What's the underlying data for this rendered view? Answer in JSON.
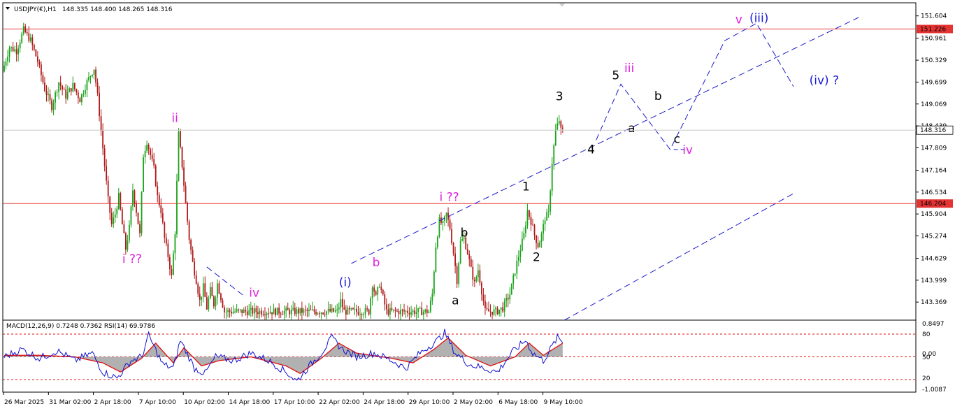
{
  "header": {
    "title": "USDJPY(€),H1",
    "ohlc": "148.335 148.400 148.265 148.316",
    "indicator_label": "MACD(12,26,9) 0.7248 0.7362  RSI(14) 69.9786"
  },
  "colors": {
    "up_candle": "#1aa31a",
    "down_candle": "#b01818",
    "hline": "#e53333",
    "price_tag_bg": "#e53333",
    "wave_blue": "#1a1ad8",
    "wave_magenta": "#e020e0",
    "wave_black": "#000000",
    "projection": "#1a1acc",
    "macd_hist": "#a8a8a8",
    "signal": "#e01010",
    "rsi": "#1010d0"
  },
  "chart_data": {
    "type": "candlestick",
    "symbol": "USDJPY(€)",
    "timeframe": "H1",
    "ylim": [
      142.85,
      151.98
    ],
    "y_ticks": [
      "151.604",
      "150.961",
      "150.329",
      "149.699",
      "149.069",
      "148.439",
      "147.809",
      "147.164",
      "146.534",
      "145.904",
      "145.274",
      "144.629",
      "143.999",
      "143.369"
    ],
    "x_ticks": [
      "26 Mar 2025",
      "31 Mar 02:00",
      "2 Apr 18:00",
      "7 Apr 10:00",
      "10 Apr 02:00",
      "14 Apr 18:00",
      "17 Apr 10:00",
      "22 Apr 02:00",
      "24 Apr 18:00",
      "29 Apr 10:00",
      "2 May 02:00",
      "6 May 18:00",
      "9 May 10:00"
    ],
    "current_price": "148.316",
    "horizontal_levels": [
      {
        "value": "151.226"
      },
      {
        "value": "146.204"
      }
    ],
    "price_path": [
      {
        "i": 0,
        "p": 150.0
      },
      {
        "i": 4,
        "p": 150.7
      },
      {
        "i": 8,
        "p": 150.6
      },
      {
        "i": 12,
        "p": 151.2
      },
      {
        "i": 16,
        "p": 150.9
      },
      {
        "i": 20,
        "p": 150.3
      },
      {
        "i": 24,
        "p": 149.5
      },
      {
        "i": 28,
        "p": 149.0
      },
      {
        "i": 32,
        "p": 149.7
      },
      {
        "i": 36,
        "p": 149.3
      },
      {
        "i": 40,
        "p": 149.6
      },
      {
        "i": 44,
        "p": 149.2
      },
      {
        "i": 48,
        "p": 149.7
      },
      {
        "i": 52,
        "p": 150.1
      },
      {
        "i": 54,
        "p": 149.3
      },
      {
        "i": 56,
        "p": 148.3
      },
      {
        "i": 58,
        "p": 147.3
      },
      {
        "i": 60,
        "p": 146.3
      },
      {
        "i": 62,
        "p": 145.6
      },
      {
        "i": 64,
        "p": 145.9
      },
      {
        "i": 66,
        "p": 146.4
      },
      {
        "i": 68,
        "p": 145.6
      },
      {
        "i": 70,
        "p": 144.9
      },
      {
        "i": 72,
        "p": 145.5
      },
      {
        "i": 74,
        "p": 146.6
      },
      {
        "i": 76,
        "p": 146.0
      },
      {
        "i": 78,
        "p": 145.3
      },
      {
        "i": 80,
        "p": 147.6
      },
      {
        "i": 82,
        "p": 148.0
      },
      {
        "i": 84,
        "p": 147.6
      },
      {
        "i": 86,
        "p": 147.2
      },
      {
        "i": 88,
        "p": 146.4
      },
      {
        "i": 90,
        "p": 146.0
      },
      {
        "i": 92,
        "p": 145.2
      },
      {
        "i": 94,
        "p": 144.7
      },
      {
        "i": 96,
        "p": 144.1
      },
      {
        "i": 98,
        "p": 145.4
      },
      {
        "i": 100,
        "p": 148.2
      },
      {
        "i": 102,
        "p": 147.3
      },
      {
        "i": 104,
        "p": 146.2
      },
      {
        "i": 106,
        "p": 145.2
      },
      {
        "i": 108,
        "p": 144.5
      },
      {
        "i": 110,
        "p": 144.0
      },
      {
        "i": 112,
        "p": 143.4
      },
      {
        "i": 114,
        "p": 143.8
      },
      {
        "i": 116,
        "p": 143.2
      },
      {
        "i": 118,
        "p": 143.7
      },
      {
        "i": 120,
        "p": 143.3
      },
      {
        "i": 122,
        "p": 143.9
      },
      {
        "i": 124,
        "p": 143.5
      },
      {
        "i": 126,
        "p": 143.1
      },
      {
        "i": 190,
        "p": 143.1
      },
      {
        "i": 192,
        "p": 143.4
      },
      {
        "i": 194,
        "p": 143.1
      },
      {
        "i": 208,
        "p": 143.1
      },
      {
        "i": 210,
        "p": 143.9
      },
      {
        "i": 212,
        "p": 143.5
      },
      {
        "i": 214,
        "p": 143.9
      },
      {
        "i": 216,
        "p": 143.5
      },
      {
        "i": 218,
        "p": 143.1
      },
      {
        "i": 242,
        "p": 143.1
      },
      {
        "i": 244,
        "p": 143.6
      },
      {
        "i": 246,
        "p": 145.0
      },
      {
        "i": 248,
        "p": 145.7
      },
      {
        "i": 250,
        "p": 145.6
      },
      {
        "i": 252,
        "p": 145.9
      },
      {
        "i": 254,
        "p": 145.5
      },
      {
        "i": 256,
        "p": 144.8
      },
      {
        "i": 258,
        "p": 144.0
      },
      {
        "i": 260,
        "p": 145.1
      },
      {
        "i": 262,
        "p": 145.2
      },
      {
        "i": 264,
        "p": 144.8
      },
      {
        "i": 266,
        "p": 144.3
      },
      {
        "i": 268,
        "p": 143.9
      },
      {
        "i": 270,
        "p": 144.3
      },
      {
        "i": 272,
        "p": 143.7
      },
      {
        "i": 274,
        "p": 143.1
      },
      {
        "i": 280,
        "p": 143.1
      },
      {
        "i": 284,
        "p": 143.2
      },
      {
        "i": 288,
        "p": 143.6
      },
      {
        "i": 292,
        "p": 144.5
      },
      {
        "i": 296,
        "p": 145.3
      },
      {
        "i": 298,
        "p": 146.0
      },
      {
        "i": 300,
        "p": 145.7
      },
      {
        "i": 302,
        "p": 145.3
      },
      {
        "i": 304,
        "p": 145.0
      },
      {
        "i": 306,
        "p": 145.3
      },
      {
        "i": 308,
        "p": 145.8
      },
      {
        "i": 310,
        "p": 145.9
      },
      {
        "i": 312,
        "p": 147.4
      },
      {
        "i": 314,
        "p": 148.3
      },
      {
        "i": 316,
        "p": 148.6
      },
      {
        "i": 317,
        "p": 148.3
      }
    ],
    "bar_count": 318,
    "wave_labels": [
      {
        "text": "ii",
        "group": "magenta",
        "i": 95,
        "p": 148.55
      },
      {
        "text": "i ??",
        "group": "magenta",
        "i": 67,
        "p": 144.5
      },
      {
        "text": "iv",
        "group": "magenta",
        "i": 139,
        "p": 143.52
      },
      {
        "text": "(i)",
        "group": "blue",
        "i": 190,
        "p": 143.83
      },
      {
        "text": "b",
        "group": "magenta",
        "i": 209,
        "p": 144.4
      },
      {
        "text": "i ??",
        "group": "magenta",
        "i": 247,
        "p": 146.28
      },
      {
        "text": "b",
        "group": "black",
        "i": 259,
        "p": 145.25
      },
      {
        "text": "a",
        "group": "black",
        "i": 254,
        "p": 143.3
      },
      {
        "text": "1",
        "group": "black",
        "i": 294,
        "p": 146.58
      },
      {
        "text": "2",
        "group": "black",
        "i": 300,
        "p": 144.55
      },
      {
        "text": "3",
        "group": "black",
        "i": 313,
        "p": 149.17
      },
      {
        "text": "4",
        "group": "black",
        "i": 331,
        "p": 147.65
      },
      {
        "text": "5",
        "group": "black",
        "i": 345,
        "p": 149.78
      },
      {
        "text": "iii",
        "group": "magenta",
        "i": 352,
        "p": 149.99
      },
      {
        "text": "a",
        "group": "black",
        "i": 354,
        "p": 148.26
      },
      {
        "text": "b",
        "group": "black",
        "i": 369,
        "p": 149.18
      },
      {
        "text": "c",
        "group": "black",
        "i": 380,
        "p": 147.95
      },
      {
        "text": "iv",
        "group": "magenta",
        "i": 385,
        "p": 147.64
      },
      {
        "text": "v",
        "group": "magenta",
        "i": 415,
        "p": 151.39
      },
      {
        "text": "(iii)",
        "group": "blue",
        "i": 423,
        "p": 151.43
      },
      {
        "text": "(iv) ?",
        "group": "blue",
        "i": 457,
        "p": 149.64
      }
    ],
    "projection_path": [
      {
        "i": 336,
        "p": 148.03
      },
      {
        "i": 350,
        "p": 149.64
      },
      {
        "i": 378,
        "p": 147.76
      },
      {
        "i": 409,
        "p": 150.89
      },
      {
        "i": 427,
        "p": 151.39
      },
      {
        "i": 448,
        "p": 149.57
      }
    ],
    "c_segment": [
      {
        "i": 380,
        "p": 147.76
      },
      {
        "i": 388,
        "p": 147.76
      }
    ],
    "trend_lines": [
      {
        "from": {
          "i": 197,
          "p": 144.48
        },
        "to": {
          "i": 485,
          "p": 151.56
        }
      },
      {
        "from": {
          "i": 318,
          "p": 142.85
        },
        "to": {
          "i": 448,
          "p": 146.49
        }
      },
      {
        "from": {
          "i": 115,
          "p": 144.38
        },
        "to": {
          "i": 136,
          "p": 143.55
        }
      }
    ]
  },
  "indicator": {
    "ylim": [
      -1.0087,
      0.8497
    ],
    "right_labels": [
      "0.8497",
      "80",
      "0.00",
      "50",
      "20",
      "-1.0087"
    ],
    "dashed_levels": [
      80,
      50,
      20
    ],
    "rsi_anchors": [
      {
        "i": 0,
        "v": 50
      },
      {
        "i": 10,
        "v": 60
      },
      {
        "i": 20,
        "v": 48
      },
      {
        "i": 30,
        "v": 58
      },
      {
        "i": 40,
        "v": 45
      },
      {
        "i": 50,
        "v": 55
      },
      {
        "i": 56,
        "v": 30
      },
      {
        "i": 64,
        "v": 22
      },
      {
        "i": 72,
        "v": 45
      },
      {
        "i": 78,
        "v": 50
      },
      {
        "i": 82,
        "v": 78
      },
      {
        "i": 90,
        "v": 40
      },
      {
        "i": 96,
        "v": 35
      },
      {
        "i": 100,
        "v": 72
      },
      {
        "i": 108,
        "v": 35
      },
      {
        "i": 114,
        "v": 28
      },
      {
        "i": 120,
        "v": 50
      },
      {
        "i": 130,
        "v": 45
      },
      {
        "i": 140,
        "v": 55
      },
      {
        "i": 150,
        "v": 45
      },
      {
        "i": 160,
        "v": 30
      },
      {
        "i": 166,
        "v": 18
      },
      {
        "i": 174,
        "v": 40
      },
      {
        "i": 180,
        "v": 55
      },
      {
        "i": 186,
        "v": 75
      },
      {
        "i": 192,
        "v": 60
      },
      {
        "i": 200,
        "v": 50
      },
      {
        "i": 210,
        "v": 55
      },
      {
        "i": 220,
        "v": 45
      },
      {
        "i": 228,
        "v": 35
      },
      {
        "i": 236,
        "v": 55
      },
      {
        "i": 246,
        "v": 72
      },
      {
        "i": 250,
        "v": 82
      },
      {
        "i": 256,
        "v": 55
      },
      {
        "i": 264,
        "v": 40
      },
      {
        "i": 272,
        "v": 35
      },
      {
        "i": 280,
        "v": 30
      },
      {
        "i": 288,
        "v": 55
      },
      {
        "i": 296,
        "v": 72
      },
      {
        "i": 300,
        "v": 55
      },
      {
        "i": 306,
        "v": 45
      },
      {
        "i": 310,
        "v": 60
      },
      {
        "i": 314,
        "v": 75
      },
      {
        "i": 317,
        "v": 70
      }
    ],
    "signal_anchors": [
      {
        "i": 0,
        "v": 52
      },
      {
        "i": 20,
        "v": 52
      },
      {
        "i": 40,
        "v": 50
      },
      {
        "i": 56,
        "v": 42
      },
      {
        "i": 66,
        "v": 30
      },
      {
        "i": 78,
        "v": 48
      },
      {
        "i": 86,
        "v": 68
      },
      {
        "i": 96,
        "v": 42
      },
      {
        "i": 102,
        "v": 62
      },
      {
        "i": 112,
        "v": 38
      },
      {
        "i": 122,
        "v": 45
      },
      {
        "i": 140,
        "v": 50
      },
      {
        "i": 160,
        "v": 38
      },
      {
        "i": 168,
        "v": 28
      },
      {
        "i": 180,
        "v": 48
      },
      {
        "i": 190,
        "v": 68
      },
      {
        "i": 200,
        "v": 55
      },
      {
        "i": 220,
        "v": 48
      },
      {
        "i": 232,
        "v": 42
      },
      {
        "i": 244,
        "v": 60
      },
      {
        "i": 252,
        "v": 75
      },
      {
        "i": 262,
        "v": 52
      },
      {
        "i": 276,
        "v": 38
      },
      {
        "i": 290,
        "v": 50
      },
      {
        "i": 298,
        "v": 68
      },
      {
        "i": 306,
        "v": 52
      },
      {
        "i": 317,
        "v": 68
      }
    ]
  }
}
